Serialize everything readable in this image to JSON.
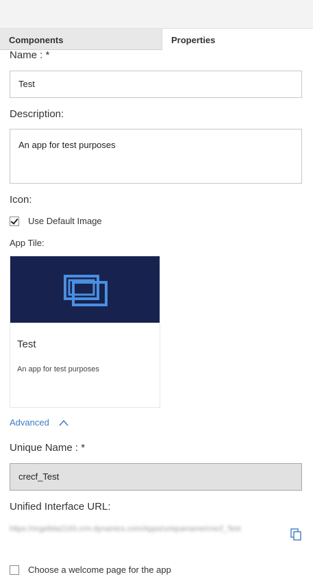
{
  "tabs": {
    "components": "Components",
    "properties": "Properties"
  },
  "form": {
    "name_label": "Name : *",
    "name_value": "Test",
    "description_label": "Description:",
    "description_value": "An app for test purposes",
    "icon_label": "Icon:",
    "use_default_image_label": "Use Default Image",
    "use_default_image_checked": true,
    "app_tile_label": "App Tile:",
    "tile_title": "Test",
    "tile_description": "An app for test purposes",
    "advanced_label": "Advanced",
    "unique_name_label": "Unique Name : *",
    "unique_name_value": "crecf_Test",
    "unified_url_label": "Unified Interface URL:",
    "unified_url_value": "https://orge8da2193.crm.dynamics.com/Apps/uniquename/crecf_Test",
    "welcome_page_label": "Choose a welcome page for the app",
    "welcome_page_checked": false
  },
  "colors": {
    "tile_banner": "#17224f",
    "tile_icon": "#4a8fe0",
    "accent_link": "#3f7bc5"
  },
  "icons": {
    "tile": "app-window-stack-icon",
    "advanced": "chevron-up-icon",
    "copy": "copy-icon"
  }
}
